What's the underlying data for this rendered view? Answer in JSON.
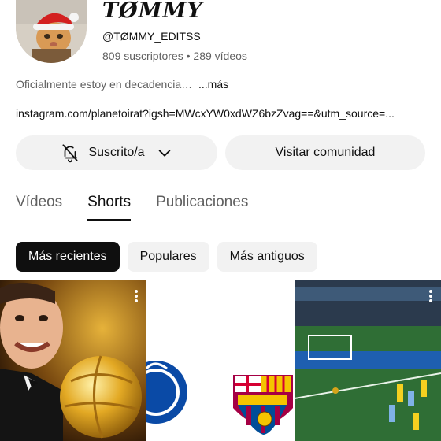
{
  "channel": {
    "name": "TØMMY",
    "handle": "@TØMMY_EDITSS",
    "subscribers": "809 suscriptores",
    "separator": "•",
    "videos": "289 vídeos",
    "description": "Oficialmente estoy en decadencia…",
    "more_label": "...más",
    "link": "instagram.com/planetoirat?igsh=MWcxYW0xdWZ6bzZvag==&utm_source=..."
  },
  "actions": {
    "subscribed_label": "Suscrito/a",
    "community_label": "Visitar comunidad",
    "subscribed_icon": "bell-slash-icon",
    "dropdown_icon": "chevron-down-icon"
  },
  "tabs": [
    {
      "label": "Vídeos",
      "active": false
    },
    {
      "label": "Shorts",
      "active": true
    },
    {
      "label": "Publicaciones",
      "active": false
    }
  ],
  "filters": [
    {
      "label": "Más recientes",
      "active": true
    },
    {
      "label": "Populares",
      "active": false
    },
    {
      "label": "Más antiguos",
      "active": false
    }
  ],
  "shorts": [
    {
      "thumbnail": "messi-ballon-dor",
      "menu_icon": "more-vert-icon"
    },
    {
      "thumbnail": "chelsea-vs-barcelona-crests",
      "menu_icon": "none"
    },
    {
      "thumbnail": "football-match-goal",
      "menu_icon": "more-vert-icon"
    }
  ],
  "colors": {
    "chip_active_bg": "#0f0f0f",
    "chip_bg": "#f2f2f2",
    "secondary_text": "#606060"
  }
}
